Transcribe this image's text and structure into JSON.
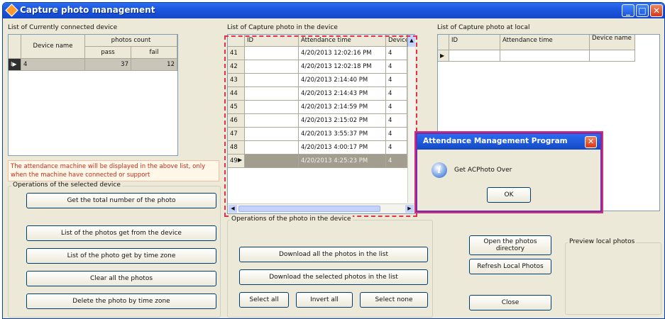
{
  "window": {
    "title": "Capture photo management",
    "controls": {
      "minimize": "_",
      "maximize": "□",
      "close": "✕"
    }
  },
  "connected": {
    "label": "List of Currently connected device",
    "header_device": "Device name",
    "header_count": "photos count",
    "header_pass": "pass",
    "header_fail": "fail",
    "rows": [
      {
        "device": "4",
        "pass": "37",
        "fail": "12"
      }
    ],
    "note": "The attendance machine will be displayed in the above list, only when the machine have connected or support"
  },
  "ops_selected": {
    "label": "Operations of the selected device",
    "buttons": [
      "Get the total number of the photo",
      "List of the photos get from the device",
      "List of the photo get by time zone",
      "Clear all the photos",
      "Delete the photo by time zone"
    ]
  },
  "device_photos": {
    "label": "List of Capture photo in the device",
    "col_id": "ID",
    "col_time": "Attendance time",
    "col_device": "Device",
    "rows": [
      {
        "n": "41",
        "id": "",
        "time": "4/20/2013 12:02:16 PM",
        "device": "4"
      },
      {
        "n": "42",
        "id": "",
        "time": "4/20/2013 12:02:18 PM",
        "device": "4"
      },
      {
        "n": "43",
        "id": "",
        "time": "4/20/2013 2:14:40 PM",
        "device": "4"
      },
      {
        "n": "44",
        "id": "",
        "time": "4/20/2013 2:14:43 PM",
        "device": "4"
      },
      {
        "n": "45",
        "id": "",
        "time": "4/20/2013 2:14:59 PM",
        "device": "4"
      },
      {
        "n": "46",
        "id": "",
        "time": "4/20/2013 2:15:02 PM",
        "device": "4"
      },
      {
        "n": "47",
        "id": "",
        "time": "4/20/2013 3:55:37 PM",
        "device": "4"
      },
      {
        "n": "48",
        "id": "",
        "time": "4/20/2013 4:00:17 PM",
        "device": "4"
      },
      {
        "n": "49",
        "id": "",
        "time": "4/20/2013 4:25:23 PM",
        "device": "4"
      }
    ]
  },
  "ops_device_photos": {
    "label": "Operations of the photo in the device",
    "download_all": "Download all the photos in the list",
    "download_selected": "Download the selected photos in the list",
    "select_all": "Select all",
    "invert_all": "Invert all",
    "select_none": "Select none"
  },
  "local_photos": {
    "label": "List of Capture photo at local",
    "col_id": "ID",
    "col_time": "Attendance time",
    "col_device": "Device name"
  },
  "local_buttons": {
    "open_dir": "Open the photos directory",
    "refresh": "Refresh Local Photos",
    "close": "Close"
  },
  "preview": {
    "label": "Preview local photos"
  },
  "dialog": {
    "title": "Attendance Management Program",
    "message": "Get ACPhoto Over",
    "ok": "OK",
    "close": "✕",
    "info_glyph": "i"
  },
  "colors": {
    "titlebar": "#1c56e0",
    "window_bg": "#ece9d8",
    "highlight_dash": "#e3324e",
    "selected_row": "#a39d90",
    "note_text": "#cc2a1a"
  }
}
